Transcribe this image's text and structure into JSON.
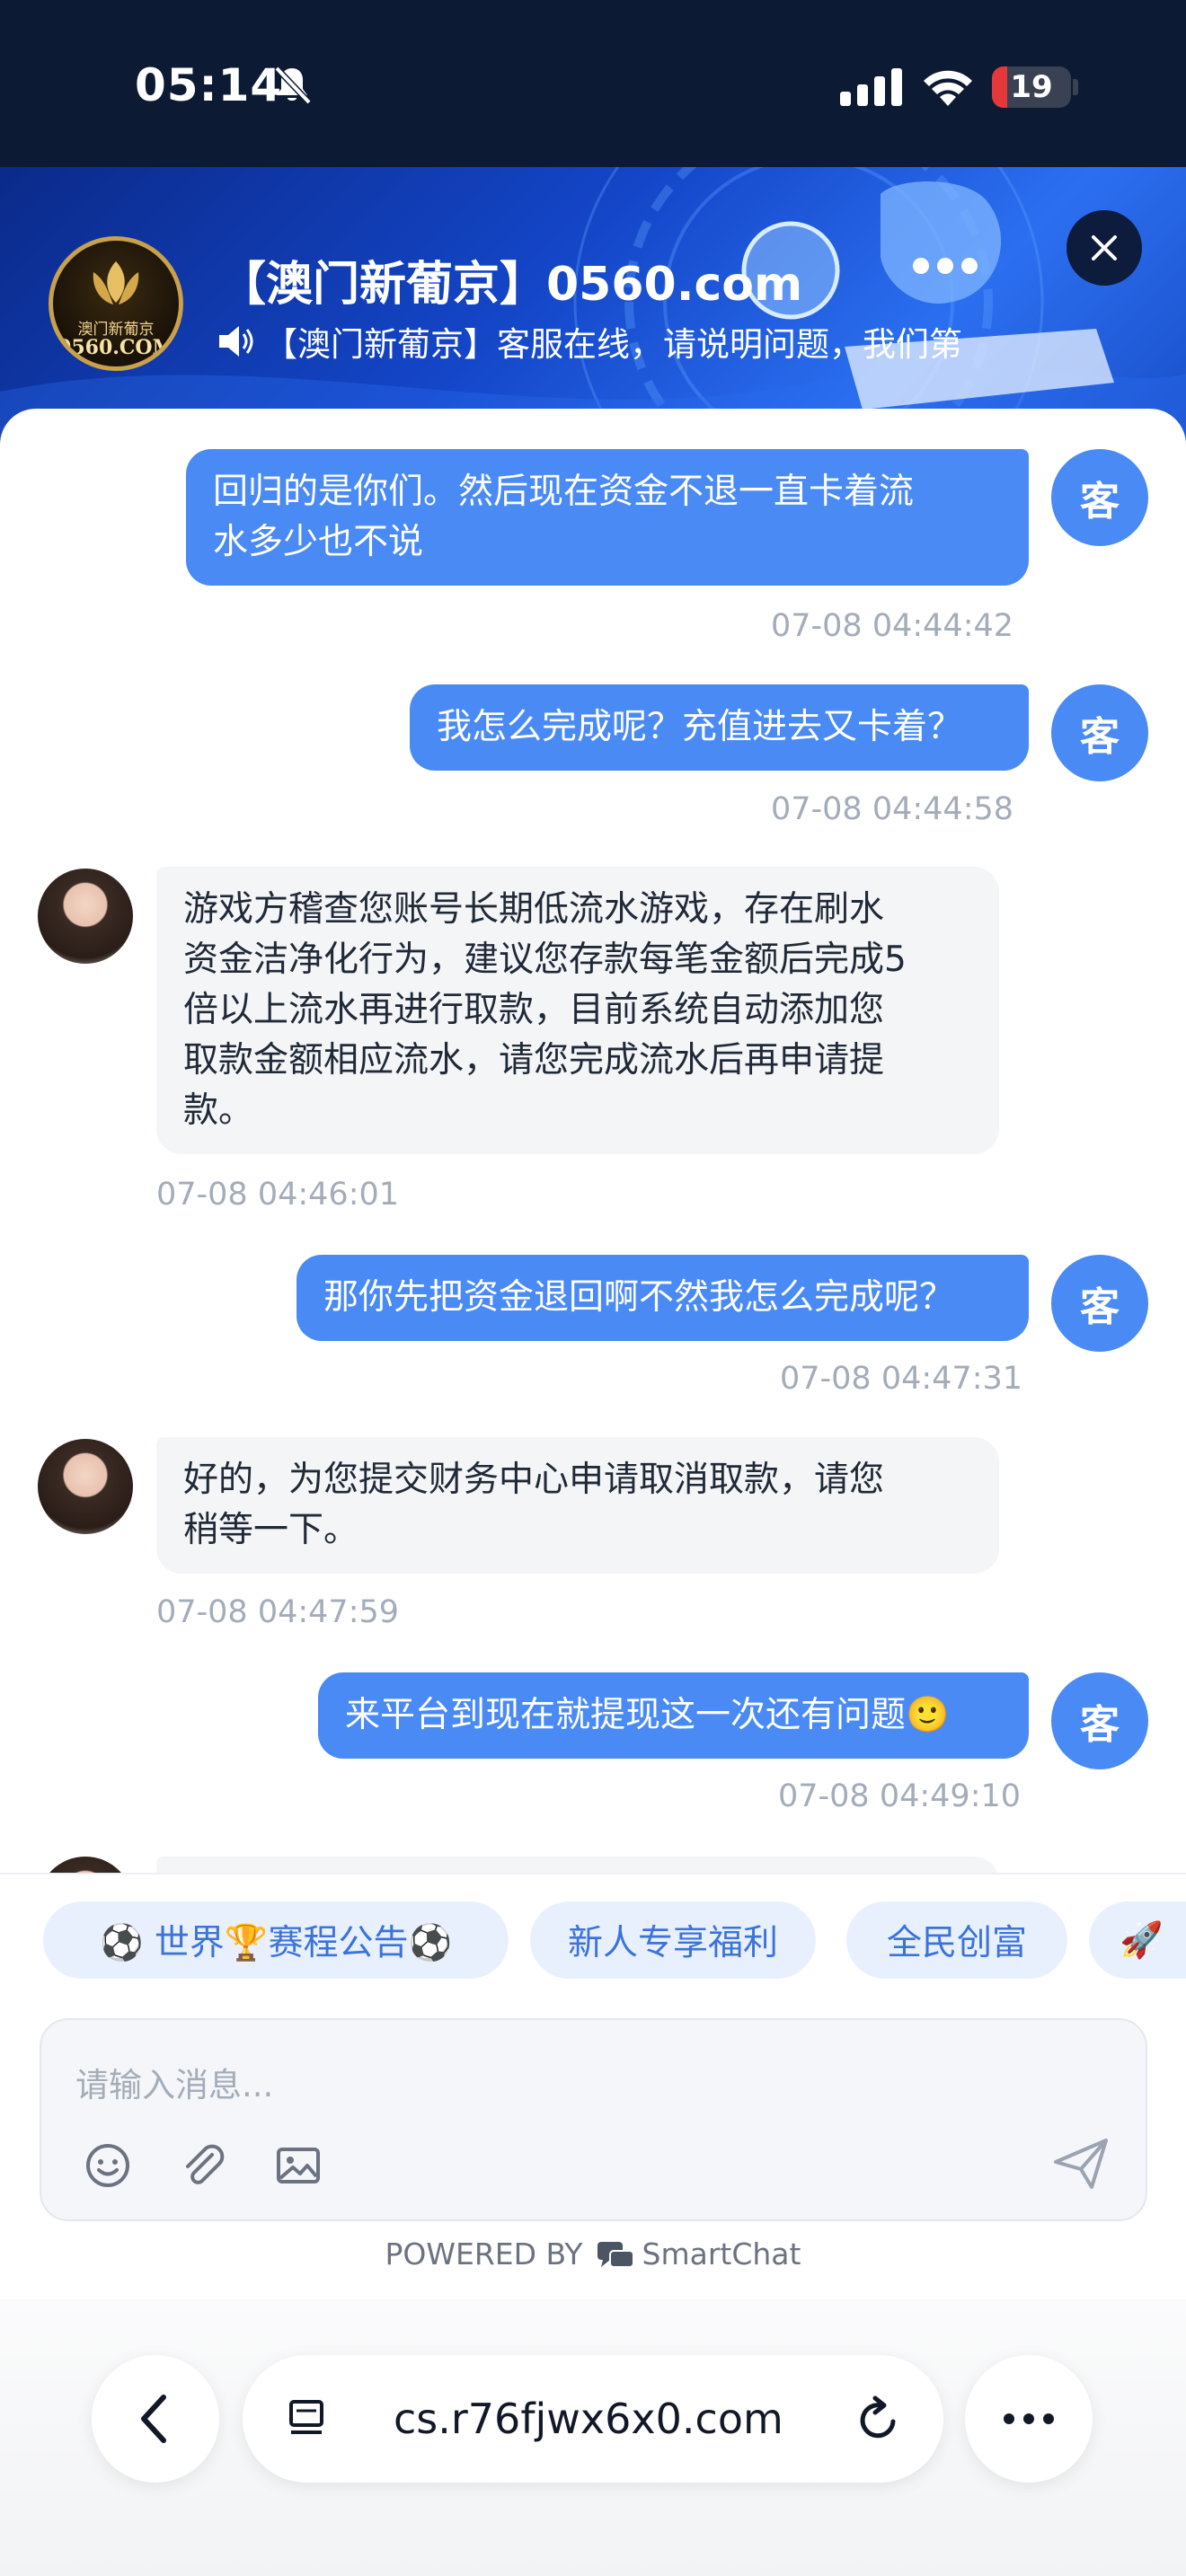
{
  "status_bar": {
    "time": "05:14",
    "battery": "19",
    "battery_level": 0.19,
    "icons": [
      "bell-slash-icon",
      "signal-icon",
      "wifi-icon",
      "battery-icon"
    ]
  },
  "header": {
    "title": "【澳门新葡京】0560.com",
    "notice": "【澳门新葡京】客服在线，请说明问题，我们第",
    "logo_text_top": "澳门新葡京",
    "logo_text_bottom": "0560.COM",
    "icons": [
      "speaker-icon",
      "close-icon"
    ]
  },
  "messages": [
    {
      "from": "user",
      "avatar": "客",
      "text_lines": [
        "回归的是你们。然后现在资金不退一直卡着流",
        "水多少也不说"
      ],
      "time": "07-08 04:44:42"
    },
    {
      "from": "user",
      "avatar": "客",
      "text_lines": [
        "我怎么完成呢？充值进去又卡着？"
      ],
      "time": "07-08 04:44:58"
    },
    {
      "from": "agent",
      "text_lines": [
        "游戏方稽查您账号长期低流水游戏，存在刷水",
        "资金洁净化行为，建议您存款每笔金额后完成5",
        "倍以上流水再进行取款，目前系统自动添加您",
        "取款金额相应流水，请您完成流水后再申请提",
        "款。"
      ],
      "time": "07-08 04:46:01"
    },
    {
      "from": "user",
      "avatar": "客",
      "text_lines": [
        "那你先把资金退回啊不然我怎么完成呢？"
      ],
      "time": "07-08 04:47:31"
    },
    {
      "from": "agent",
      "text_lines": [
        "好的，为您提交财务中心申请取消取款，请您",
        "稍等一下。"
      ],
      "time": "07-08 04:47:59"
    },
    {
      "from": "user",
      "avatar": "客",
      "text_lines": [
        "来平台到现在就提现这一次还有问题🙂"
      ],
      "time": "07-08 04:49:10"
    }
  ],
  "quick_replies": [
    "⚽ 世界🏆赛程公告⚽",
    "新人专享福利",
    "全民创富",
    "🚀"
  ],
  "input": {
    "placeholder": "请输入消息...",
    "tools": [
      "emoji-icon",
      "attachment-icon",
      "image-icon",
      "send-icon"
    ]
  },
  "footer": {
    "powered_by": "POWERED BY",
    "brand": "SmartChat"
  },
  "browser": {
    "url": "cs.r76fjwx6x0.com",
    "icons": [
      "back-icon",
      "reader-icon",
      "reload-icon",
      "more-icon"
    ]
  },
  "colors": {
    "accent": "#4a8af4",
    "header_bg": "#1446c8",
    "status_bg": "#0c1a33",
    "bubble_in": "#f4f5f7",
    "timestamp": "#a3acb9"
  }
}
